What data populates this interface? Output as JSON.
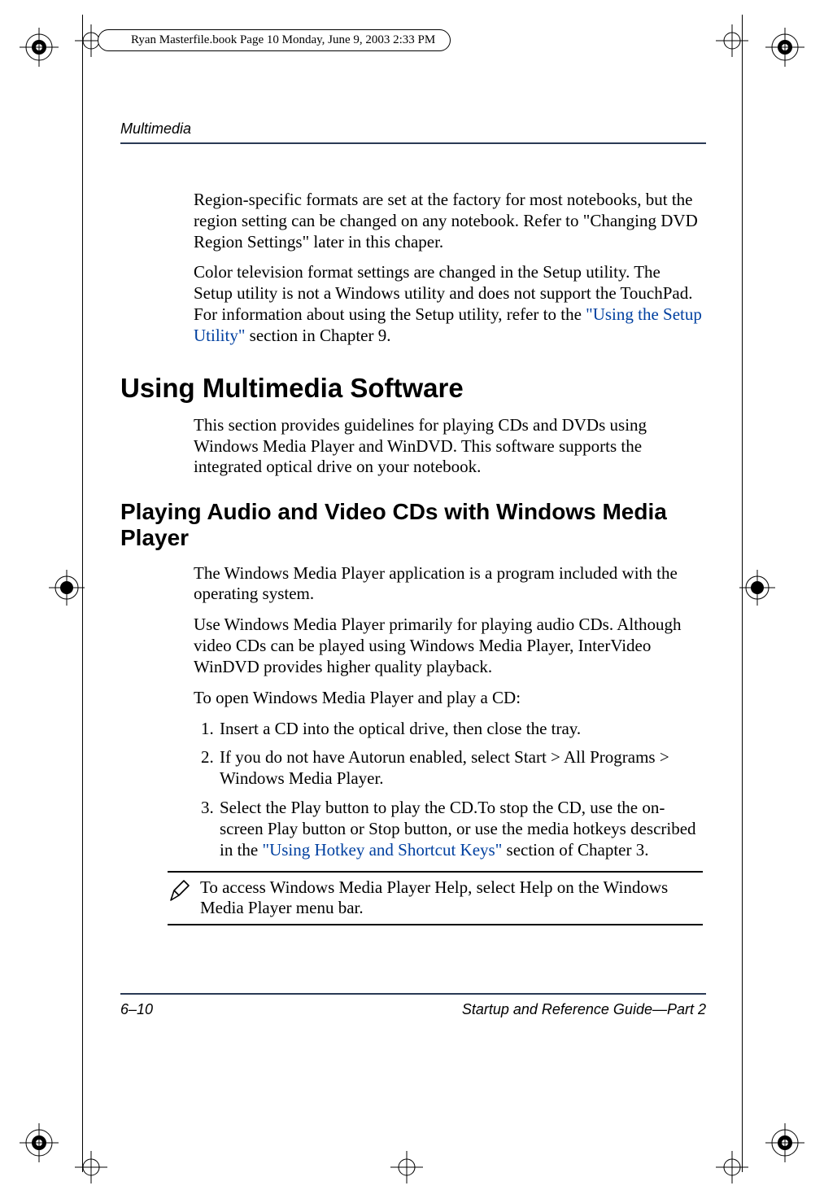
{
  "print_header": "Ryan Masterfile.book  Page 10  Monday, June 9, 2003  2:33 PM",
  "running_head": "Multimedia",
  "para1": "Region-specific formats are set at the factory for most notebooks, but the region setting can be changed on any notebook. Refer to \"Changing DVD Region Settings\" later in this chaper.",
  "para2_pre": "Color television format settings are changed in the Setup utility. The Setup utility is not a Windows utility and does not support the TouchPad. For information about using the Setup utility, refer to the ",
  "para2_link": "\"Using the Setup Utility\"",
  "para2_post": " section in Chapter 9.",
  "h1": "Using Multimedia Software",
  "para3": "This section provides guidelines for playing CDs and DVDs using Windows Media Player and WinDVD. This software supports the integrated optical drive on your notebook.",
  "h2": "Playing Audio and Video CDs with Windows Media Player",
  "para4": "The Windows Media Player application is a program included with the operating system.",
  "para5": "Use Windows Media Player primarily for playing audio CDs. Although video CDs can be played using Windows Media Player, InterVideo WinDVD provides higher quality playback.",
  "para6": "To open Windows Media Player and play a CD:",
  "steps": {
    "s1": "Insert a CD into the optical drive, then close the tray.",
    "s2": "If you do not have Autorun enabled, select Start > All Programs > Windows Media Player.",
    "s3_pre": "Select the Play button to play the CD.To stop the CD, use the on-screen Play button or Stop button, or use the media hotkeys described in the ",
    "s3_link": "\"Using Hotkey and Shortcut Keys\"",
    "s3_post": " section of Chapter 3."
  },
  "note": "To access Windows Media Player Help, select Help on the Windows Media Player menu bar.",
  "footer_left": "6–10",
  "footer_right": "Startup and Reference Guide—Part 2"
}
